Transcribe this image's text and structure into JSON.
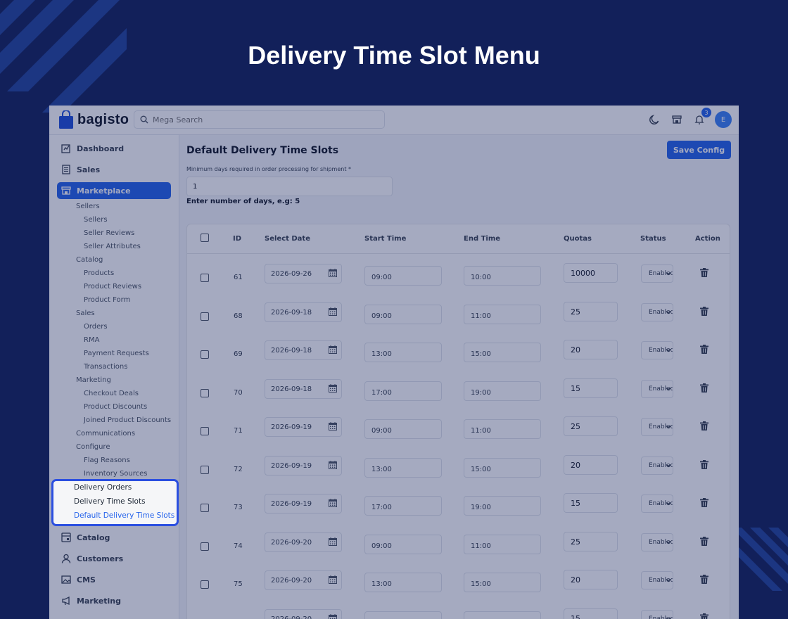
{
  "hero": {
    "title": "Delivery Time Slot Menu"
  },
  "header": {
    "logo_text": "bagisto",
    "search_placeholder": "Mega Search",
    "notification_count": "3",
    "avatar_initial": "E"
  },
  "sidebar": {
    "top_items": [
      {
        "label": "Dashboard",
        "icon": "dashboard-icon"
      },
      {
        "label": "Sales",
        "icon": "receipt-icon"
      },
      {
        "label": "Marketplace",
        "icon": "store-icon",
        "active": true
      },
      {
        "label": "Catalog",
        "icon": "catalog-icon"
      },
      {
        "label": "Customers",
        "icon": "user-icon"
      },
      {
        "label": "CMS",
        "icon": "image-icon"
      },
      {
        "label": "Marketing",
        "icon": "megaphone-icon"
      }
    ],
    "marketplace_tree": [
      {
        "label": "Sellers",
        "level": 1
      },
      {
        "label": "Sellers",
        "level": 2
      },
      {
        "label": "Seller Reviews",
        "level": 2
      },
      {
        "label": "Seller Attributes",
        "level": 2
      },
      {
        "label": "Catalog",
        "level": 1
      },
      {
        "label": "Products",
        "level": 2
      },
      {
        "label": "Product Reviews",
        "level": 2
      },
      {
        "label": "Product Form",
        "level": 2
      },
      {
        "label": "Sales",
        "level": 1
      },
      {
        "label": "Orders",
        "level": 2
      },
      {
        "label": "RMA",
        "level": 2
      },
      {
        "label": "Payment Requests",
        "level": 2
      },
      {
        "label": "Transactions",
        "level": 2
      },
      {
        "label": "Marketing",
        "level": 1
      },
      {
        "label": "Checkout Deals",
        "level": 2
      },
      {
        "label": "Product Discounts",
        "level": 2
      },
      {
        "label": "Joined Product Discounts",
        "level": 2
      },
      {
        "label": "Communications",
        "level": 1
      },
      {
        "label": "Configure",
        "level": 1
      },
      {
        "label": "Flag Reasons",
        "level": 2
      },
      {
        "label": "Inventory Sources",
        "level": 2
      }
    ],
    "highlighted_items": [
      {
        "label": "Delivery Orders"
      },
      {
        "label": "Delivery Time Slots"
      },
      {
        "label": "Default Delivery Time Slots",
        "selected": true
      }
    ]
  },
  "main": {
    "title": "Default Delivery Time Slots",
    "save_label": "Save Config",
    "min_days_label": "Minimum days required in order processing for shipment *",
    "min_days_value": "1",
    "min_days_hint": "Enter number of days, e.g: 5",
    "table": {
      "columns": [
        "ID",
        "Select Date",
        "Start Time",
        "End Time",
        "Quotas",
        "Status",
        "Action"
      ],
      "rows": [
        {
          "id": "61",
          "date": "2026-09-26",
          "start": "09:00",
          "end": "10:00",
          "quota": "10000",
          "status": "Enabled"
        },
        {
          "id": "68",
          "date": "2026-09-18",
          "start": "09:00",
          "end": "11:00",
          "quota": "25",
          "status": "Enabled"
        },
        {
          "id": "69",
          "date": "2026-09-18",
          "start": "13:00",
          "end": "15:00",
          "quota": "20",
          "status": "Enabled"
        },
        {
          "id": "70",
          "date": "2026-09-18",
          "start": "17:00",
          "end": "19:00",
          "quota": "15",
          "status": "Enabled"
        },
        {
          "id": "71",
          "date": "2026-09-19",
          "start": "09:00",
          "end": "11:00",
          "quota": "25",
          "status": "Enabled"
        },
        {
          "id": "72",
          "date": "2026-09-19",
          "start": "13:00",
          "end": "15:00",
          "quota": "20",
          "status": "Enabled"
        },
        {
          "id": "73",
          "date": "2026-09-19",
          "start": "17:00",
          "end": "19:00",
          "quota": "15",
          "status": "Enabled"
        },
        {
          "id": "74",
          "date": "2026-09-20",
          "start": "09:00",
          "end": "11:00",
          "quota": "25",
          "status": "Enabled"
        },
        {
          "id": "75",
          "date": "2026-09-20",
          "start": "13:00",
          "end": "15:00",
          "quota": "20",
          "status": "Enabled"
        },
        {
          "id": "76",
          "date": "2026-09-20",
          "start": "17:00",
          "end": "19:00",
          "quota": "15",
          "status": "Enabled"
        }
      ]
    }
  },
  "colors": {
    "background": "#12205a",
    "accent": "#2563eb",
    "highlight_border": "#2b4fe0"
  }
}
